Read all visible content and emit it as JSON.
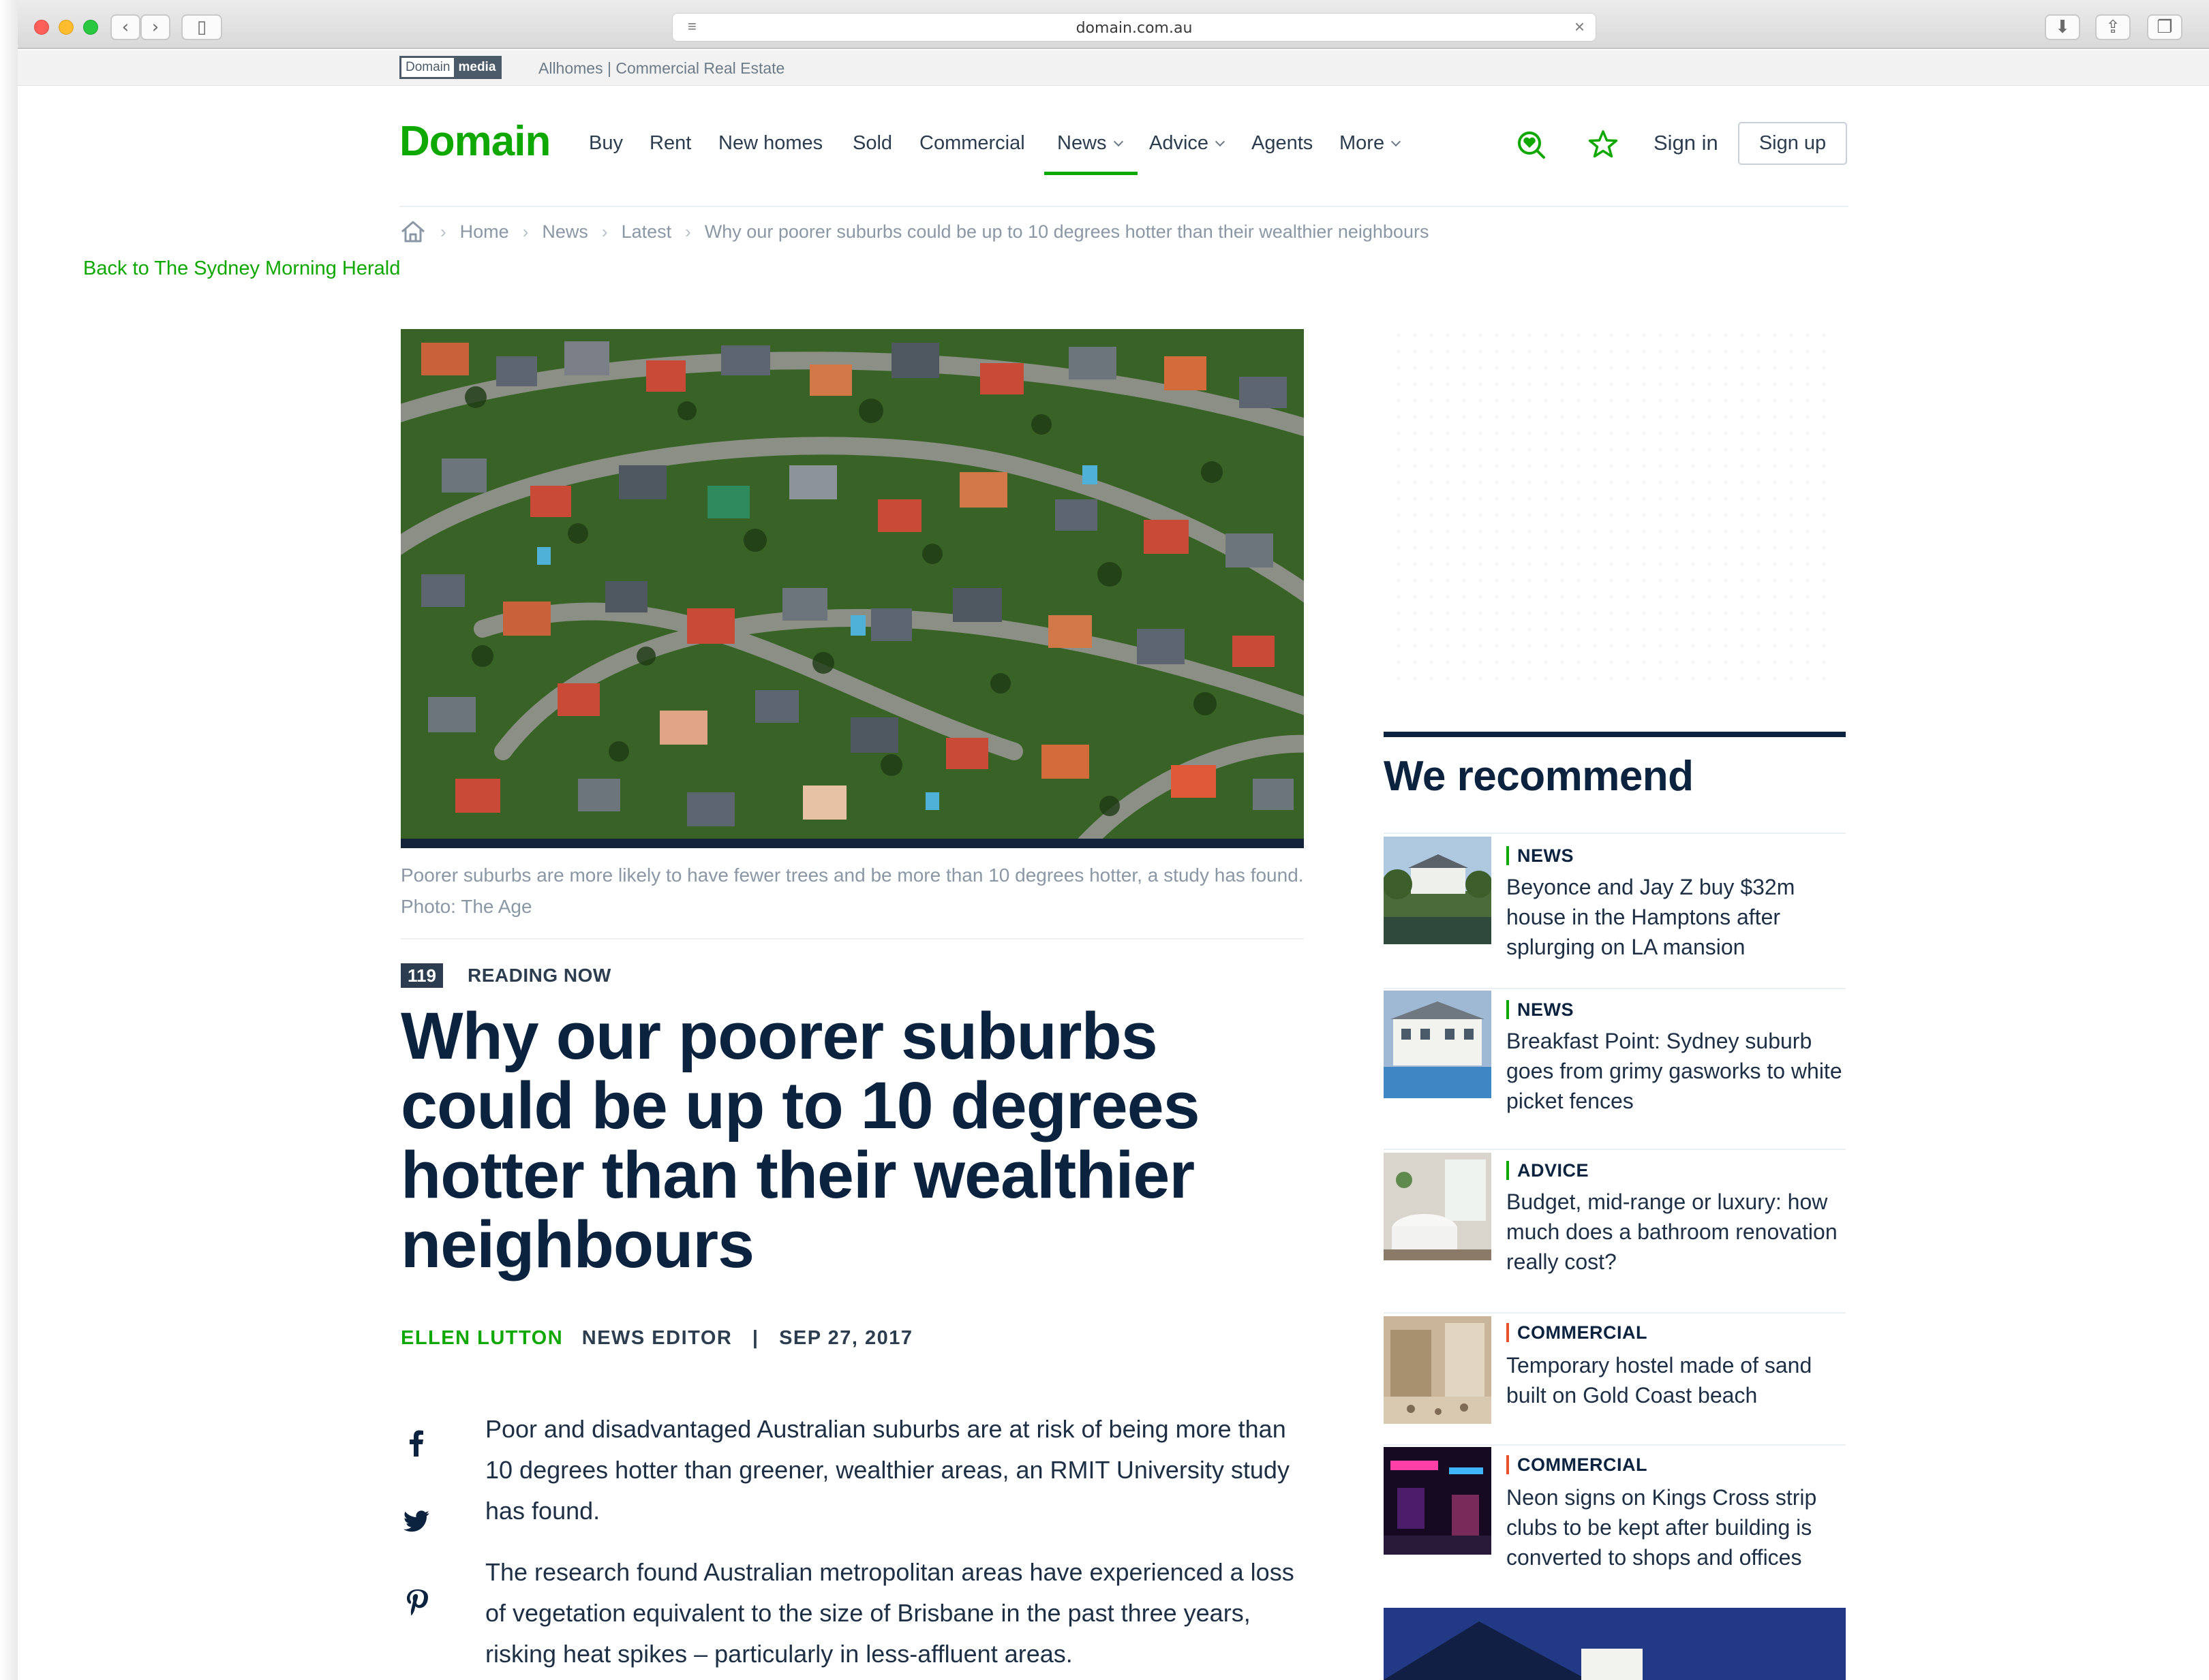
{
  "browser": {
    "url": "domain.com.au"
  },
  "network_bar": {
    "logo_left": "Domain",
    "logo_right": "media",
    "links": "Allhomes | Commercial Real Estate"
  },
  "header": {
    "logo": "Domain",
    "nav": [
      "Buy",
      "Rent",
      "New homes",
      "Sold",
      "Commercial",
      "News",
      "Advice",
      "Agents",
      "More"
    ],
    "active_nav": "News",
    "sign_in": "Sign in",
    "sign_up": "Sign up",
    "accent_color": "#0ea800"
  },
  "breadcrumb": [
    "Home",
    "News",
    "Latest",
    "Why our poorer suburbs could be up to 10 degrees hotter than their wealthier neighbours"
  ],
  "back_link": "Back to The Sydney Morning Herald",
  "article": {
    "caption": "Poorer suburbs are more likely to have fewer trees and be more than 10 degrees hotter, a study has found. Photo: The Age",
    "reading_count": "119",
    "reading_label": "READING NOW",
    "headline": "Why our poorer suburbs could be up to 10 degrees hotter than their wealthier neighbours",
    "author": "ELLEN LUTTON",
    "role": "NEWS EDITOR",
    "separator": "|",
    "date": "SEP 27, 2017",
    "paragraphs": [
      "Poor and disadvantaged Australian suburbs are at risk of being more than 10 degrees hotter than greener, wealthier areas, an RMIT University study has found.",
      "The research found Australian metropolitan areas have experienced a loss of vegetation equivalent to the size of Brisbane in the past three years, risking heat spikes – particularly in less-affluent areas."
    ]
  },
  "recommend": {
    "title": "We recommend",
    "items": [
      {
        "tag": "NEWS",
        "title": "Beyonce and Jay Z buy $32m house in the Hamptons after splurging on LA mansion"
      },
      {
        "tag": "NEWS",
        "title": "Breakfast Point: Sydney suburb goes from grimy gasworks to white picket fences"
      },
      {
        "tag": "ADVICE",
        "title": "Budget, mid-range or luxury: how much does a bathroom renovation really cost?"
      },
      {
        "tag": "COMMERCIAL",
        "title": "Temporary hostel made of sand built on Gold Coast beach"
      },
      {
        "tag": "COMMERCIAL",
        "title": "Neon signs on Kings Cross strip clubs to be kept after building is converted to shops and offices"
      }
    ]
  }
}
